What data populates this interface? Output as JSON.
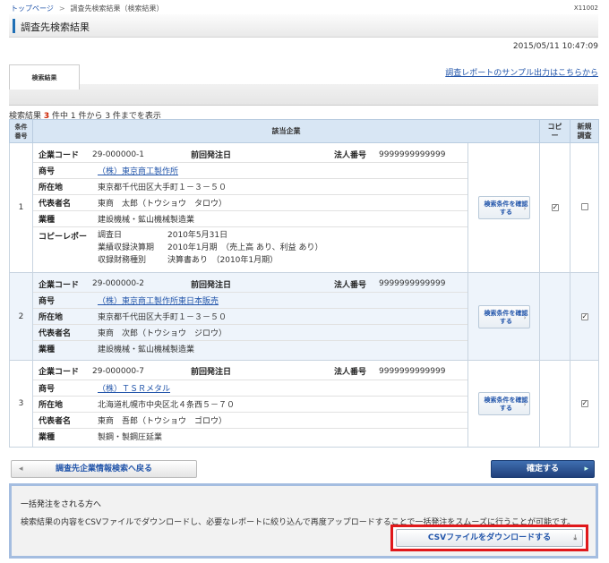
{
  "breadcrumb": {
    "items": [
      "トップページ",
      "調査先検索結果（検索結果）"
    ]
  },
  "screen_id": "X11002",
  "page_title": "調査先検索結果",
  "datetime": "2015/05/11 10:47:09",
  "tab": {
    "label": "検索結果"
  },
  "sample_link": "調査レポートのサンプル出力はこちらから",
  "summary": {
    "prefix": "検索結果",
    "count": "3",
    "middle": "件中 1 件から 3 件までを表示"
  },
  "table": {
    "headers": {
      "no": "条件番号",
      "company": "該当企業",
      "copy": "コピー",
      "new": "新規調査"
    },
    "labels": {
      "code": "企業コード",
      "prev": "前回発注日",
      "corp": "法人番号",
      "name": "商号",
      "address": "所在地",
      "rep": "代表者名",
      "industry": "業種",
      "copy_report": "コピーレポート",
      "survey_date": "調査日",
      "fiscal": "業績収録決算期",
      "financial": "収録財務種別"
    },
    "confirm_button": "検索条件を確認する",
    "rows": [
      {
        "no": "1",
        "code": "29-000000-1",
        "prev_date": "",
        "corp_no": "9999999999999",
        "name": "（株）東京商工製作所",
        "address": "東京都千代田区大手町１－３－５０",
        "rep": "東商　太郎（トウショウ　タロウ）",
        "industry": "建設機械・鉱山機械製造業",
        "copy_report": {
          "survey_date": "2010年5月31日",
          "fiscal": "2010年1月期　（売上高 あり、利益 あり）",
          "financial": "決算書あり　（2010年1月期）"
        },
        "copy_checked": true,
        "new_checked": false
      },
      {
        "no": "2",
        "code": "29-000000-2",
        "prev_date": "",
        "corp_no": "9999999999999",
        "name": "（株）東京商工製作所東日本販売",
        "address": "東京都千代田区大手町１－３－５０",
        "rep": "東商　次郎（トウショウ　ジロウ）",
        "industry": "建設機械・鉱山機械製造業",
        "copy_checked": null,
        "new_checked": true
      },
      {
        "no": "3",
        "code": "29-000000-7",
        "prev_date": "",
        "corp_no": "9999999999999",
        "name": "（株）ＴＳＲメタル",
        "address": "北海道札幌市中央区北４条西５－７０",
        "rep": "東商　吾郎（トウショウ　ゴロウ）",
        "industry": "製鋼・製鋼圧延業",
        "copy_checked": null,
        "new_checked": true
      }
    ]
  },
  "buttons": {
    "back": "調査先企業情報検索へ戻る",
    "confirm": "確定する"
  },
  "bulk": {
    "title": "一括発注をされる方へ",
    "desc": "検索結果の内容をCSVファイルでダウンロードし、必要なレポートに絞り込んで再度アップロードすることで一括発注をスムーズに行うことが可能です。",
    "csv_button": "CSVファイルをダウンロードする"
  },
  "colors": {
    "accent": "#1f6fb5",
    "header_bg": "#d8e6f4",
    "highlight": "#e0181b",
    "confirm_btn": "#2a4f8f"
  },
  "icons": {
    "download": "download-icon",
    "back": "left-arrow-icon",
    "forward": "right-arrow-icon"
  }
}
